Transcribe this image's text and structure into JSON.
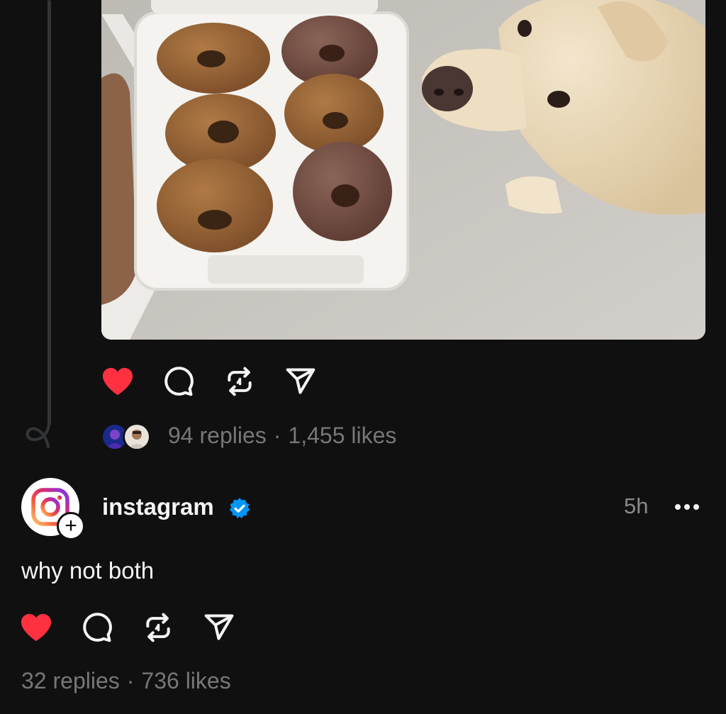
{
  "post_1": {
    "image_alt": "Box of six donuts held next to a golden retriever",
    "stats": {
      "replies": "94 replies",
      "separator": "·",
      "likes": "1,455 likes"
    },
    "liked": true
  },
  "post_2": {
    "author": {
      "username": "instagram",
      "verified": true
    },
    "timestamp": "5h",
    "text": "why not both",
    "stats": {
      "replies": "32 replies",
      "separator": "·",
      "likes": "736 likes"
    },
    "liked": true
  },
  "icons": {
    "heart": "heart-icon",
    "comment": "comment-icon",
    "repost": "repost-icon",
    "share": "share-icon",
    "more": "more-icon",
    "verified": "verified-badge-icon",
    "follow": "plus-icon"
  },
  "colors": {
    "background": "#101010",
    "like_red": "#ff3040",
    "verified_blue": "#0095f6",
    "muted_text": "#777777",
    "primary_text": "#f3f5f7"
  }
}
